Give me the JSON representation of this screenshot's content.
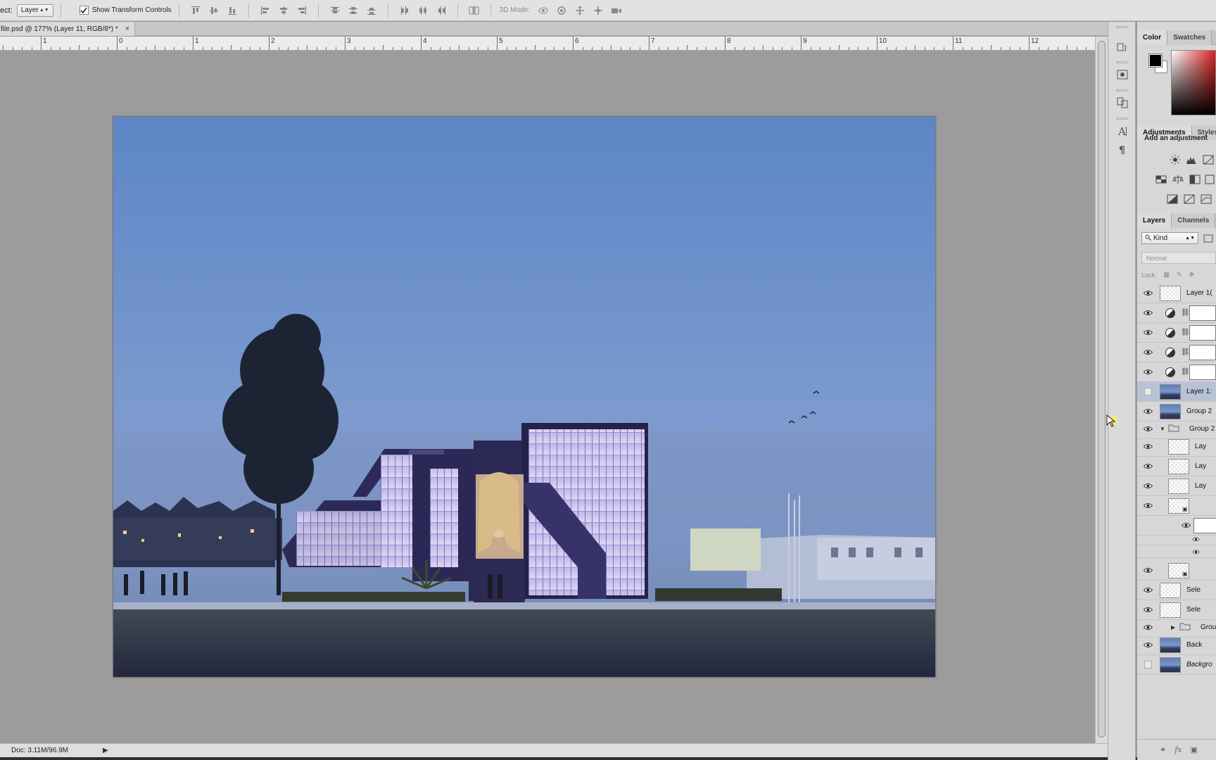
{
  "options_bar": {
    "select_label": "ect:",
    "select_value": "Layer",
    "show_transform_label": "Show Transform Controls",
    "show_transform_checked": true,
    "mode3d_label": "3D Mode:"
  },
  "document_tab": {
    "title": "file.psd @ 177% (Layer 11, RGB/8*) *",
    "close": "×"
  },
  "ruler": {
    "numbers": [
      "1",
      "0",
      "1",
      "2",
      "3",
      "4",
      "5",
      "6",
      "7",
      "8",
      "9",
      "10",
      "11",
      "12"
    ]
  },
  "status": {
    "doc_size": "Doc: 3.11M/96.9M",
    "play": "▶"
  },
  "color_panel": {
    "tabs": [
      "Color",
      "Swatches"
    ],
    "foreground": "#000000",
    "background": "#ffffff"
  },
  "adjustments_panel": {
    "tabs": [
      "Adjustments",
      "Styles"
    ],
    "title": "Add an adjustment"
  },
  "layers_panel": {
    "tabs": [
      "Layers",
      "Channels"
    ],
    "filter_kind": "Kind",
    "blend_mode": "Normal",
    "lock_label": "Lock:",
    "layers": [
      {
        "name": "Layer 1(",
        "type": "layer",
        "visible": true
      },
      {
        "name": "",
        "type": "adjustment",
        "visible": true
      },
      {
        "name": "",
        "type": "adjustment",
        "visible": true
      },
      {
        "name": "",
        "type": "adjustment",
        "visible": true
      },
      {
        "name": "",
        "type": "adjustment",
        "visible": true
      },
      {
        "name": "Layer 1:",
        "type": "photo",
        "visible": false,
        "selected": true
      },
      {
        "name": "Group 2",
        "type": "photo",
        "visible": true
      },
      {
        "name": "Group 2",
        "type": "group-open",
        "visible": true
      },
      {
        "name": "Lay",
        "type": "layer",
        "visible": true
      },
      {
        "name": "Lay",
        "type": "layer",
        "visible": true
      },
      {
        "name": "Lay",
        "type": "layer",
        "visible": true
      },
      {
        "name": "",
        "type": "smart",
        "visible": true
      },
      {
        "name": "",
        "type": "mask",
        "visible": true
      },
      {
        "name": "",
        "type": "sub",
        "visible": true
      },
      {
        "name": "",
        "type": "sub",
        "visible": true
      },
      {
        "name": "",
        "type": "smart",
        "visible": true
      },
      {
        "name": "Sele",
        "type": "layer",
        "visible": true
      },
      {
        "name": "Sele",
        "type": "layer",
        "visible": true
      },
      {
        "name": "Grou",
        "type": "group-closed",
        "visible": true
      },
      {
        "name": "Back",
        "type": "photo",
        "visible": true
      },
      {
        "name": "Backgro",
        "type": "photo",
        "visible": false,
        "italic": true
      }
    ]
  }
}
